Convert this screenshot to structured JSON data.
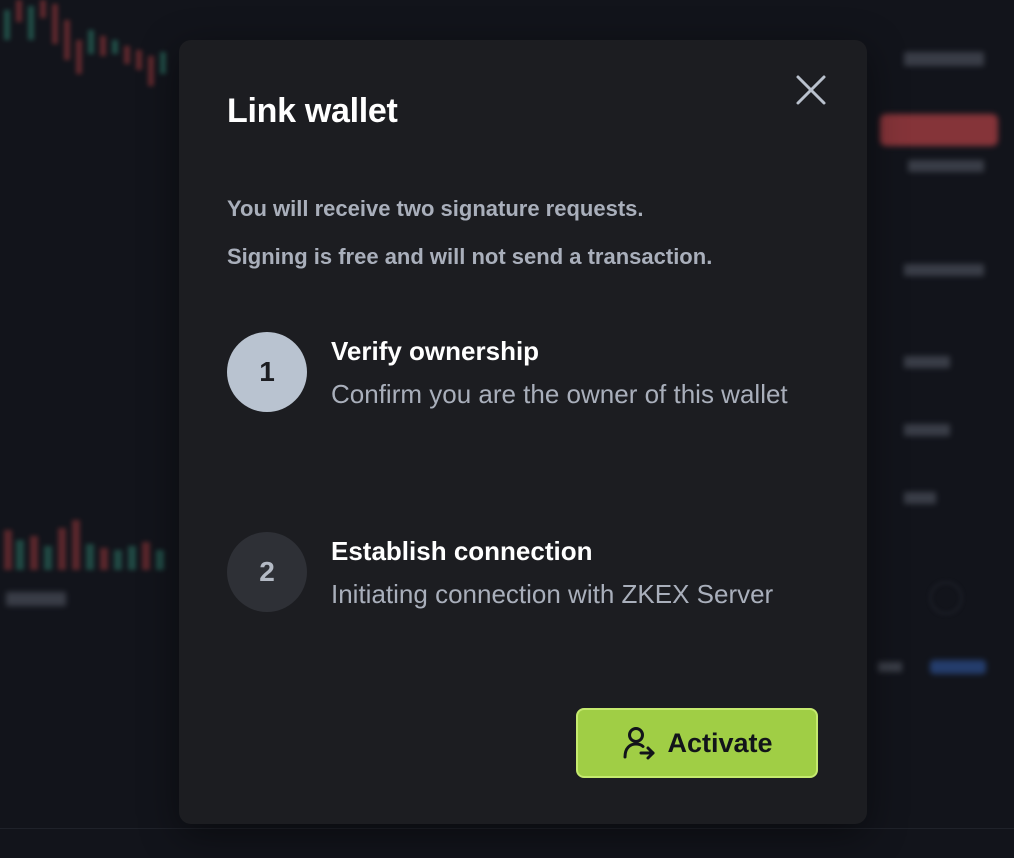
{
  "modal": {
    "title": "Link wallet",
    "description_lines": [
      "You will receive two signature requests.",
      "Signing is free and will not send a transaction."
    ],
    "steps": [
      {
        "number": "1",
        "title": "Verify ownership",
        "description": "Confirm you are the owner of this wallet",
        "state": "active"
      },
      {
        "number": "2",
        "title": "Establish connection",
        "description": "Initiating connection with ZKEX Server",
        "state": "pending"
      }
    ],
    "close_icon": "close-icon",
    "activate_button": {
      "label": "Activate",
      "icon": "user-arrow-icon"
    }
  },
  "colors": {
    "modal_background": "#1c1d21",
    "accent_green": "#a0ce45",
    "step_active": "#b9c3d0",
    "step_pending": "#2e3036",
    "muted_text": "#a9afbb"
  }
}
